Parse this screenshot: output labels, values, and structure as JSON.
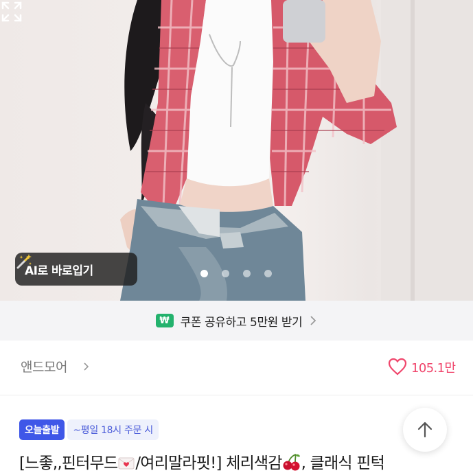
{
  "hero": {
    "image_description": "",
    "ai_button_label": "AI로 바로입기",
    "ai_button_icon": "magic-wand-icon",
    "carousel": {
      "total": 4,
      "active_index": 0
    },
    "expand_icon": "expand-icon"
  },
  "coupon": {
    "won_badge": "₩",
    "text": "쿠폰 공유하고 5만원 받기",
    "accent": "#23b26d"
  },
  "shop": {
    "name": "앤드모어",
    "likes": "105.1만",
    "like_color": "#f0466c"
  },
  "product": {
    "badge_today": "오늘출발",
    "badge_time": "~평일 18시 주문 시",
    "title_part1": "[느좋,,핀터무드",
    "title_part2": "/여리말라핏!] 체리색감",
    "title_part3": ", 클래식 핀턱"
  },
  "colors": {
    "badge_blue": "#3f57e8",
    "badge_bg": "#eef1fc"
  }
}
